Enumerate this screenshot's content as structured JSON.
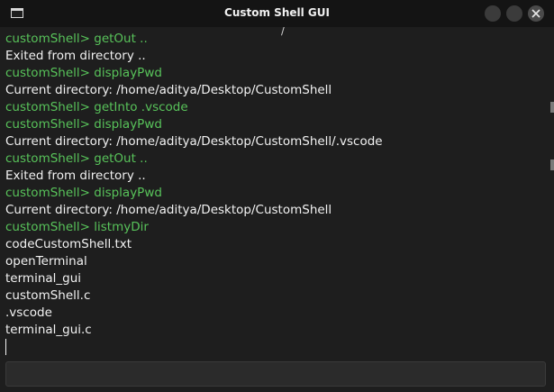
{
  "window": {
    "title": "Custom Shell GUI"
  },
  "terminal": {
    "partial_top_glyph": "/",
    "lines": [
      {
        "type": "cmd",
        "text": "customShell> getOut .."
      },
      {
        "type": "out",
        "text": "Exited from directory .."
      },
      {
        "type": "cmd",
        "text": "customShell> displayPwd"
      },
      {
        "type": "out",
        "text": "Current directory: /home/aditya/Desktop/CustomShell"
      },
      {
        "type": "cmd",
        "text": "customShell> getInto .vscode"
      },
      {
        "type": "cmd",
        "text": "customShell> displayPwd"
      },
      {
        "type": "out",
        "text": "Current directory: /home/aditya/Desktop/CustomShell/.vscode"
      },
      {
        "type": "cmd",
        "text": "customShell> getOut .."
      },
      {
        "type": "out",
        "text": "Exited from directory .."
      },
      {
        "type": "cmd",
        "text": "customShell> displayPwd"
      },
      {
        "type": "out",
        "text": "Current directory: /home/aditya/Desktop/CustomShell"
      },
      {
        "type": "cmd",
        "text": "customShell> listmyDir"
      },
      {
        "type": "out",
        "text": "codeCustomShell.txt"
      },
      {
        "type": "out",
        "text": "openTerminal"
      },
      {
        "type": "out",
        "text": "terminal_gui"
      },
      {
        "type": "out",
        "text": "customShell.c"
      },
      {
        "type": "out",
        "text": ".vscode"
      },
      {
        "type": "out",
        "text": "terminal_gui.c"
      }
    ]
  },
  "input": {
    "value": "",
    "placeholder": ""
  },
  "icons": {
    "app": "terminal-window-icon",
    "close": "close-icon"
  },
  "colors": {
    "background": "#1e1e1e",
    "titlebar": "#141414",
    "prompt": "#58c35a",
    "output_text": "#f2f2f2",
    "input_bg": "#2b2b2b"
  }
}
